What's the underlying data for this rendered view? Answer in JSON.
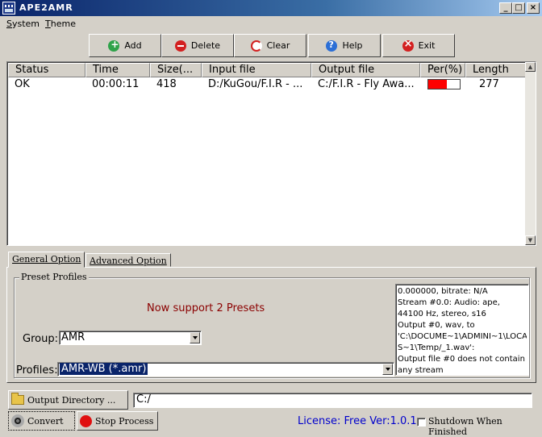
{
  "window": {
    "title": "APE2AMR",
    "min_glyph": "_",
    "max_glyph": "□",
    "close_glyph": "×"
  },
  "menu": [
    {
      "label": "System",
      "mnemonic": "S"
    },
    {
      "label": "Theme",
      "mnemonic": "T"
    }
  ],
  "toolbar": {
    "add": "Add",
    "delete": "Delete",
    "clear": "Clear",
    "help": "Help",
    "exit": "Exit"
  },
  "list": {
    "columns": [
      "Status",
      "Time",
      "Size(...",
      "Input file",
      "Output file",
      "Per(%)",
      "Length"
    ],
    "rows": [
      {
        "status": "OK",
        "time": "00:00:11",
        "size": "418",
        "input": "D:/KuGou/F.I.R - ...",
        "output": "C:/F.I.R - Fly Awa...",
        "percent": 60,
        "length": "277"
      }
    ],
    "scroll_up": "▲",
    "scroll_down": "▼"
  },
  "tabs": {
    "general": "General Option",
    "advanced": "Advanced Option"
  },
  "presets": {
    "legend": "Preset Profiles",
    "support_text": "Now support 2 Presets",
    "group_label": "Group:",
    "group_value": "AMR",
    "profiles_label": "Profiles:",
    "profiles_value": "AMR-WB (*.amr)"
  },
  "log_lines": [
    "0.000000, bitrate: N/A",
    "    Stream #0.0: Audio: ape,",
    "44100 Hz, stereo, s16",
    "Output #0, wav, to",
    "'C:\\DOCUME~1\\ADMINI~1\\LOCAL",
    "S~1\\Temp/_1.wav':",
    "Output file #0 does not contain",
    "any stream"
  ],
  "bottom": {
    "output_dir_button": "Output Directory ...",
    "output_dir_value": "C:/",
    "convert": "Convert",
    "stop": "Stop Process",
    "license": "License: Free Ver:1.0.1",
    "shutdown": "Shutdown When Finished"
  },
  "colors": {
    "progress_fill": "#ff0000",
    "support_text": "#8b0000",
    "license_text": "#0000cc",
    "selection": "#0a246a"
  }
}
